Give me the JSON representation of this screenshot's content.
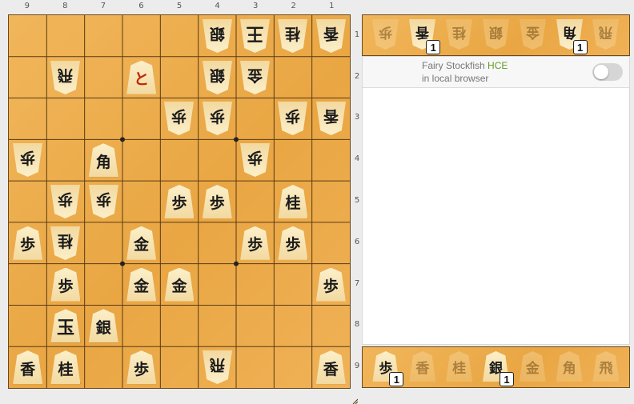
{
  "files": [
    "9",
    "8",
    "7",
    "6",
    "5",
    "4",
    "3",
    "2",
    "1"
  ],
  "ranks": [
    "1",
    "2",
    "3",
    "4",
    "5",
    "6",
    "7",
    "8",
    "9"
  ],
  "pieces": [
    {
      "file": 4,
      "rank": 1,
      "kanji": "銀",
      "side": "gote"
    },
    {
      "file": 3,
      "rank": 1,
      "kanji": "王",
      "side": "gote",
      "king": true
    },
    {
      "file": 2,
      "rank": 1,
      "kanji": "桂",
      "side": "gote"
    },
    {
      "file": 1,
      "rank": 1,
      "kanji": "香",
      "side": "gote"
    },
    {
      "file": 8,
      "rank": 2,
      "kanji": "飛",
      "side": "gote"
    },
    {
      "file": 6,
      "rank": 2,
      "kanji": "と",
      "side": "sente",
      "promoted": true
    },
    {
      "file": 4,
      "rank": 2,
      "kanji": "銀",
      "side": "gote"
    },
    {
      "file": 3,
      "rank": 2,
      "kanji": "金",
      "side": "gote"
    },
    {
      "file": 5,
      "rank": 3,
      "kanji": "歩",
      "side": "gote"
    },
    {
      "file": 4,
      "rank": 3,
      "kanji": "歩",
      "side": "gote"
    },
    {
      "file": 2,
      "rank": 3,
      "kanji": "歩",
      "side": "gote"
    },
    {
      "file": 1,
      "rank": 3,
      "kanji": "香",
      "side": "gote"
    },
    {
      "file": 9,
      "rank": 4,
      "kanji": "歩",
      "side": "gote"
    },
    {
      "file": 7,
      "rank": 4,
      "kanji": "角",
      "side": "sente"
    },
    {
      "file": 3,
      "rank": 4,
      "kanji": "歩",
      "side": "gote"
    },
    {
      "file": 8,
      "rank": 5,
      "kanji": "歩",
      "side": "gote"
    },
    {
      "file": 7,
      "rank": 5,
      "kanji": "歩",
      "side": "gote"
    },
    {
      "file": 5,
      "rank": 5,
      "kanji": "歩",
      "side": "sente"
    },
    {
      "file": 4,
      "rank": 5,
      "kanji": "歩",
      "side": "sente"
    },
    {
      "file": 2,
      "rank": 5,
      "kanji": "桂",
      "side": "sente"
    },
    {
      "file": 9,
      "rank": 6,
      "kanji": "歩",
      "side": "sente"
    },
    {
      "file": 8,
      "rank": 6,
      "kanji": "桂",
      "side": "gote"
    },
    {
      "file": 6,
      "rank": 6,
      "kanji": "金",
      "side": "sente"
    },
    {
      "file": 3,
      "rank": 6,
      "kanji": "歩",
      "side": "sente"
    },
    {
      "file": 2,
      "rank": 6,
      "kanji": "歩",
      "side": "sente"
    },
    {
      "file": 8,
      "rank": 7,
      "kanji": "歩",
      "side": "sente"
    },
    {
      "file": 6,
      "rank": 7,
      "kanji": "金",
      "side": "sente"
    },
    {
      "file": 5,
      "rank": 7,
      "kanji": "金",
      "side": "sente"
    },
    {
      "file": 1,
      "rank": 7,
      "kanji": "歩",
      "side": "sente"
    },
    {
      "file": 8,
      "rank": 8,
      "kanji": "玉",
      "side": "sente",
      "king": true
    },
    {
      "file": 7,
      "rank": 8,
      "kanji": "銀",
      "side": "sente"
    },
    {
      "file": 9,
      "rank": 9,
      "kanji": "香",
      "side": "sente"
    },
    {
      "file": 8,
      "rank": 9,
      "kanji": "桂",
      "side": "sente"
    },
    {
      "file": 6,
      "rank": 9,
      "kanji": "歩",
      "side": "sente"
    },
    {
      "file": 4,
      "rank": 9,
      "kanji": "飛",
      "side": "gote"
    },
    {
      "file": 1,
      "rank": 9,
      "kanji": "香",
      "side": "sente"
    }
  ],
  "hand_top": [
    {
      "kanji": "歩",
      "count": null
    },
    {
      "kanji": "香",
      "count": "1"
    },
    {
      "kanji": "桂",
      "count": null
    },
    {
      "kanji": "銀",
      "count": null
    },
    {
      "kanji": "金",
      "count": null
    },
    {
      "kanji": "角",
      "count": "1"
    },
    {
      "kanji": "飛",
      "count": null
    }
  ],
  "hand_bottom": [
    {
      "kanji": "歩",
      "count": "1"
    },
    {
      "kanji": "香",
      "count": null
    },
    {
      "kanji": "桂",
      "count": null
    },
    {
      "kanji": "銀",
      "count": "1"
    },
    {
      "kanji": "金",
      "count": null
    },
    {
      "kanji": "角",
      "count": null
    },
    {
      "kanji": "飛",
      "count": null
    }
  ],
  "engine": {
    "name": "Fairy Stockfish",
    "badge": "HCE",
    "subtitle": "in local browser",
    "enabled": false
  },
  "colors": {
    "board": "#e9a643",
    "grid": "#5a3a14",
    "hce": "#629924"
  }
}
